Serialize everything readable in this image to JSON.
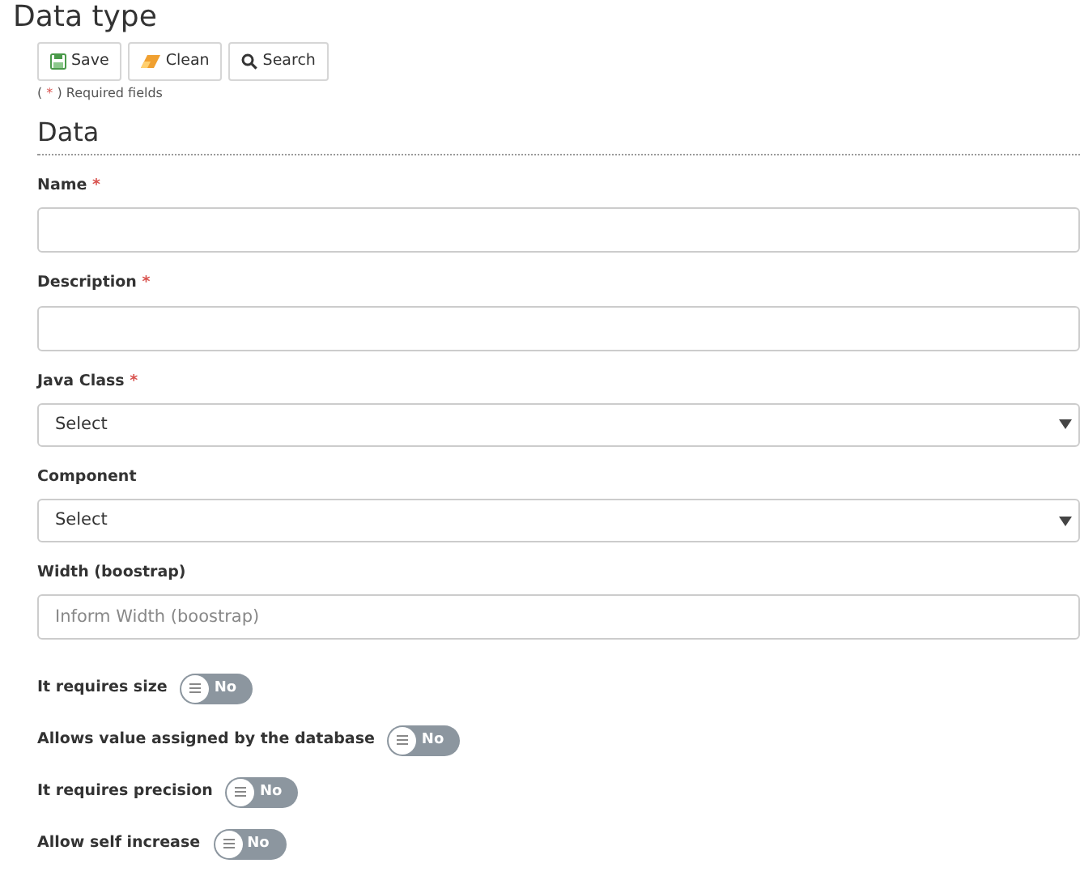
{
  "title": "Data type",
  "buttons": [
    {
      "label": "Save",
      "kind": "save"
    },
    {
      "label": "Clean",
      "kind": "clean"
    },
    {
      "label": "Search",
      "kind": "search"
    }
  ],
  "required_note": {
    "before": "(",
    "mark": "*",
    "after": ") Required fields"
  },
  "section": "Data",
  "fields": [
    {
      "kind": "text",
      "label": "Name",
      "mark": "*"
    },
    {
      "kind": "text",
      "label": "Description",
      "mark": "*"
    },
    {
      "kind": "select",
      "label": "Java Class",
      "mark": "*",
      "value": "Select"
    },
    {
      "kind": "select",
      "label": "Component",
      "value": "Select"
    },
    {
      "kind": "text",
      "label": "Width (boostrap)",
      "placeholder": "Inform Width (boostrap)"
    }
  ],
  "toggles": [
    {
      "label": "It requires size",
      "on": false,
      "text": "No"
    },
    {
      "label": "Allows value assigned by the database",
      "on": false,
      "text": "No"
    },
    {
      "label": "It requires precision",
      "on": false,
      "text": "No"
    },
    {
      "label": "Allow self increase",
      "on": false,
      "text": "No"
    }
  ]
}
